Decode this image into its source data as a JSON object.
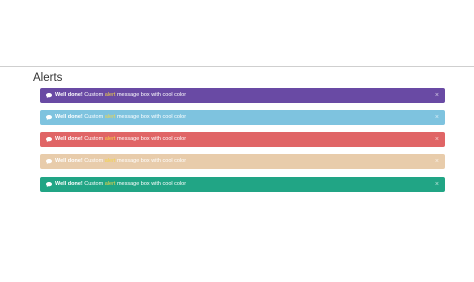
{
  "section": {
    "title": "Alerts"
  },
  "alerts": [
    {
      "color": "#694aa4",
      "strong": "Well done!",
      "before": " Custom ",
      "accent": "alert",
      "after": " message box with cool color",
      "close": "×"
    },
    {
      "color": "#7ec3df",
      "strong": "Well done!",
      "before": " Custom ",
      "accent": "alert",
      "after": " message box with cool color",
      "close": "×"
    },
    {
      "color": "#e06566",
      "strong": "Well done!",
      "before": " Custom ",
      "accent": "alert",
      "after": " message box with cool color",
      "close": "×"
    },
    {
      "color": "#e8ccab",
      "strong": "Well done!",
      "before": " Custom ",
      "accent": "alert",
      "after": " message box with cool color",
      "close": "×"
    },
    {
      "color": "#21a585",
      "strong": "Well done!",
      "before": " Custom ",
      "accent": "alert",
      "after": " message box with cool color",
      "close": "×"
    }
  ],
  "icons": {
    "alert_icon": "chat-bubble-icon"
  }
}
